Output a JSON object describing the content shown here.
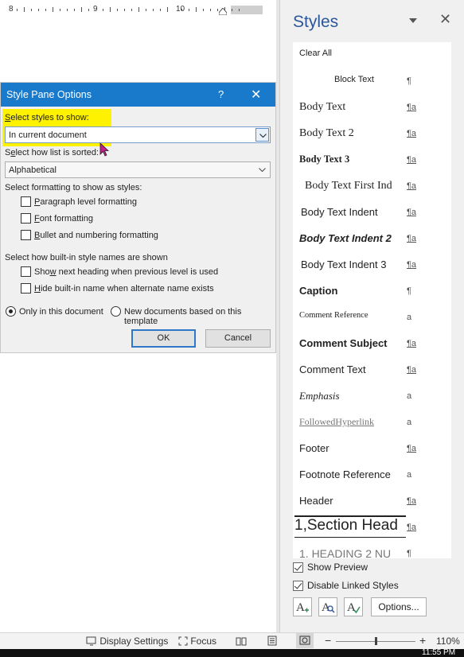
{
  "ruler": {
    "labels": [
      "8",
      "9",
      "10"
    ]
  },
  "dialog": {
    "title": "Style Pane Options",
    "help": "?",
    "close": "✕",
    "show_label_key": "S",
    "show_label_rest": "elect styles to show:",
    "show_value": "In current document",
    "sort_label_pre": "S",
    "sort_label_key": "e",
    "sort_label_rest": "lect how list is sorted:",
    "sort_value": "Alphabetical",
    "formatting_label": "Select formatting to show as styles:",
    "fmt_paragraph_key": "P",
    "fmt_paragraph_rest": "aragraph level formatting",
    "fmt_font_key": "F",
    "fmt_font_rest": "ont formatting",
    "fmt_bullet_key": "B",
    "fmt_bullet_rest": "ullet and numbering formatting",
    "builtin_label": "Select how built-in style names are shown",
    "next_heading_pre": "Sho",
    "next_heading_key": "w",
    "next_heading_rest": " next heading when previous level is used",
    "hide_builtin_key": "H",
    "hide_builtin_rest": "ide built-in name when alternate name exists",
    "only_doc": "Only in this document",
    "new_docs": "New documents based on this template",
    "ok": "OK",
    "cancel": "Cancel"
  },
  "pane": {
    "title": "Styles",
    "close": "✕",
    "styles": [
      {
        "name": "Clear All",
        "icon": ""
      },
      {
        "name": "Block Text",
        "icon": "¶"
      },
      {
        "name": "Body Text",
        "icon": "¶a"
      },
      {
        "name": "Body Text 2",
        "icon": "¶a"
      },
      {
        "name": "Body Text 3",
        "icon": "¶a"
      },
      {
        "name": "Body Text First Ind",
        "icon": "¶a"
      },
      {
        "name": "Body Text Indent",
        "icon": "¶a"
      },
      {
        "name": "Body Text Indent 2",
        "icon": "¶a"
      },
      {
        "name": "Body Text Indent 3",
        "icon": "¶a"
      },
      {
        "name": "Caption",
        "icon": "¶"
      },
      {
        "name": "Comment Reference",
        "icon": "a"
      },
      {
        "name": "Comment Subject",
        "icon": "¶a"
      },
      {
        "name": "Comment Text",
        "icon": "¶a"
      },
      {
        "name": "Emphasis",
        "icon": "a"
      },
      {
        "name": "FollowedHyperlink",
        "icon": "a"
      },
      {
        "name": "Footer",
        "icon": "¶a"
      },
      {
        "name": "Footnote Reference",
        "icon": "a"
      },
      {
        "name": "Header",
        "icon": "¶a"
      },
      {
        "name": "1,Section Head",
        "icon": "¶a"
      },
      {
        "name": "1.  HEADING 2 NU",
        "icon": "¶"
      }
    ],
    "show_preview": "Show Preview",
    "disable_linked": "Disable Linked Styles",
    "options": "Options..."
  },
  "status": {
    "display_settings": "Display Settings",
    "focus": "Focus",
    "zoom_minus": "−",
    "zoom_plus": "+",
    "zoom": "110%"
  },
  "taskbar": {
    "time": "11:55 PM"
  }
}
